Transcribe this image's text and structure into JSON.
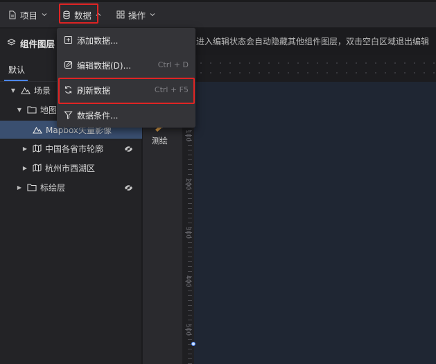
{
  "menubar": {
    "project_label": "项目",
    "data_label": "数据",
    "ops_label": "操作"
  },
  "left_panel": {
    "title": "组件图层",
    "tab_default": "默认",
    "tree": [
      {
        "label": "场景",
        "level": 0,
        "expanded": true,
        "icon": "mountain-icon"
      },
      {
        "label": "地图",
        "level": 1,
        "expanded": true,
        "icon": "folder-icon"
      },
      {
        "label": "Mapbox矢量影像",
        "level": 2,
        "selected": true,
        "icon": "mountain-icon"
      },
      {
        "label": "中国各省市轮廓",
        "level": 2,
        "icon": "map-icon",
        "hidden_eye": true
      },
      {
        "label": "杭州市西湖区",
        "level": 2,
        "icon": "map-icon"
      },
      {
        "label": "标绘层",
        "level": 1,
        "icon": "folder-icon",
        "hidden_eye": true
      }
    ]
  },
  "toolstrip": {
    "measure_label": "测绘"
  },
  "canvas": {
    "hint": "进入编辑状态会自动隐藏其他组件图层，双击空白区域退出编辑"
  },
  "ruler": {
    "labels": [
      "100",
      "200",
      "300",
      "400",
      "500"
    ]
  },
  "dropdown": {
    "items": [
      {
        "label": "添加数据...",
        "shortcut": "",
        "icon": "add-square-icon"
      },
      {
        "label": "编辑数据(D)...",
        "shortcut": "Ctrl + D",
        "icon": "edit-icon"
      },
      {
        "label": "刷新数据",
        "shortcut": "Ctrl + F5",
        "icon": "refresh-icon"
      },
      {
        "label": "数据条件...",
        "shortcut": "",
        "icon": "filter-icon"
      }
    ]
  },
  "colors": {
    "accent": "#4c86ff",
    "highlight": "#e02424",
    "selected_row": "#3a4f70"
  }
}
